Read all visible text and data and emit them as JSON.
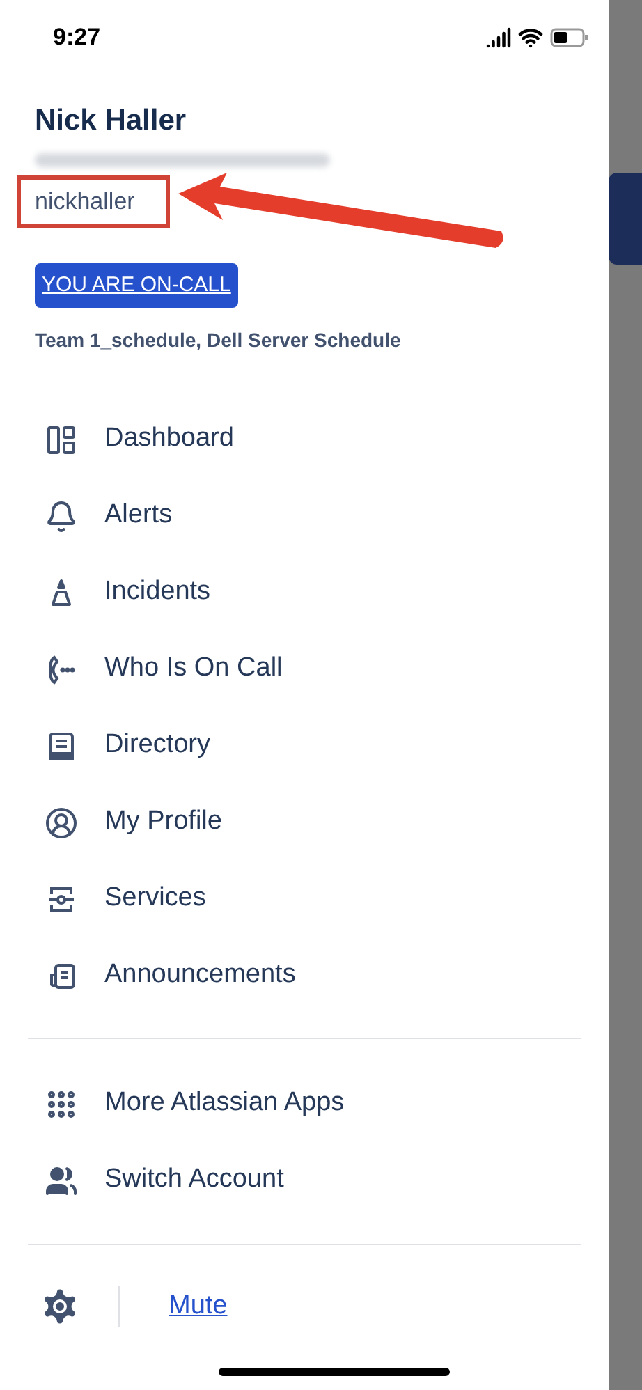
{
  "status_bar": {
    "time": "9:27"
  },
  "profile": {
    "name": "Nick Haller",
    "username": "nickhaller",
    "on_call_badge": "YOU ARE ON-CALL",
    "schedules": "Team 1_schedule, Dell Server Schedule"
  },
  "menu": [
    {
      "label": "Dashboard"
    },
    {
      "label": "Alerts"
    },
    {
      "label": "Incidents"
    },
    {
      "label": "Who Is On Call"
    },
    {
      "label": "Directory"
    },
    {
      "label": "My Profile"
    },
    {
      "label": "Services"
    },
    {
      "label": "Announcements"
    }
  ],
  "secondary_menu": [
    {
      "label": "More Atlassian Apps"
    },
    {
      "label": "Switch Account"
    }
  ],
  "footer": {
    "mute_link": "Mute"
  }
}
